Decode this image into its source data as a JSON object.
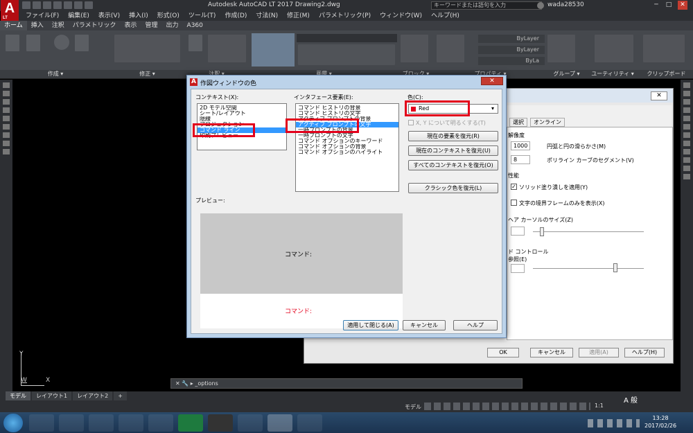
{
  "titlebar": {
    "logo": "A",
    "logo_sub": "LT",
    "app_title": "Autodesk AutoCAD LT 2017    Drawing2.dwg",
    "search_placeholder": "キーワードまたは語句を入力",
    "user": "wada28530",
    "minimize": "─",
    "maximize": "□",
    "close": "✕"
  },
  "menubar": [
    "ファイル(F)",
    "編集(E)",
    "表示(V)",
    "挿入(I)",
    "形式(O)",
    "ツール(T)",
    "作成(D)",
    "寸法(N)",
    "修正(M)",
    "パラメトリック(P)",
    "ウィンドウ(W)",
    "ヘルプ(H)"
  ],
  "ribbon_tabs": [
    "ホーム",
    "挿入",
    "注釈",
    "パラメトリック",
    "表示",
    "管理",
    "出力",
    "A360"
  ],
  "ribbon_panels": [
    "作成 ▾",
    "修正 ▾",
    "注釈 ▾",
    "画層 ▾",
    "ブロック ▾",
    "プロパティ ▾",
    "グループ ▾",
    "ユーティリティ ▾",
    "クリップボード"
  ],
  "ribbon_labels": {
    "layer": "ByLayer",
    "bylayer1": "ByLayer",
    "bylayer2": "ByLa"
  },
  "color_dialog": {
    "title": "作図ウィンドウの色",
    "close": "✕",
    "context_label": "コンテキスト(X):",
    "contexts": [
      "2D モデル空間",
      "シート/レイアウト",
      "隠線",
      "プロジェクション",
      "コマンド ライン",
      "印刷プレビュー"
    ],
    "context_selected": 4,
    "interface_label": "インタフェース要素(E):",
    "interface_items": [
      "コマンド ヒストリの背景",
      "コマンド ヒストリの文字",
      "アクティブ プロンプトの背景",
      "アクティブ プロンプトの文字",
      "一時プロンプトの背景",
      "一時プロンプトの文字",
      "コマンド オプションのキーワード",
      "コマンド オプションの背景",
      "コマンド オプションのハイライト"
    ],
    "interface_selected": 3,
    "color_label": "色(C):",
    "color_value": "Red",
    "swatch_color": "#e3001b",
    "tint_checkbox": "X, Y について明るくする(T)",
    "btn_restore_element": "現在の要素を復元(R)",
    "btn_restore_context": "現在のコンテキストを復元(U)",
    "btn_restore_all": "すべてのコンテキストを復元(O)",
    "btn_classic": "クラシック色を復元(L)",
    "preview_label": "プレビュー:",
    "preview_prompt": "コマンド:",
    "preview_prompt_red": "コマンド:",
    "btn_apply_close": "適用して閉じる(A)",
    "btn_cancel": "キャンセル",
    "btn_help": "ヘルプ"
  },
  "options_dialog": {
    "close": "✕",
    "tabs": [
      "選択",
      "オンライン"
    ],
    "section_resolution": "解像度",
    "arc_value": "1000",
    "arc_label": "円弧と円の滑らかさ(M)",
    "poly_value": "8",
    "poly_label": "ポリライン カーブのセグメント(V)",
    "section_perf": "性能",
    "solid_fill": "ソリッド塗り潰しを適用(Y)",
    "text_frame": "文字の境界フレームのみを表示(X)",
    "section_crosshair": "ヘア カーソルのサイズ(Z)",
    "section_fade": "ド コントロール",
    "fade_ref": "参照(E)",
    "btn_ok": "OK",
    "btn_cancel": "キャンセル",
    "btn_apply": "適用(A)",
    "btn_help": "ヘルプ(H)"
  },
  "command_line": {
    "text": "_options"
  },
  "ucs": {
    "y": "Y",
    "w": "W",
    "x": "X"
  },
  "layout_tabs": [
    "モデル",
    "レイアウト1",
    "レイアウト2",
    "+"
  ],
  "status": {
    "model": "モデル",
    "scale": "1:1",
    "ime": "A 般"
  },
  "clock": {
    "time": "13:28",
    "date": "2017/02/26"
  }
}
